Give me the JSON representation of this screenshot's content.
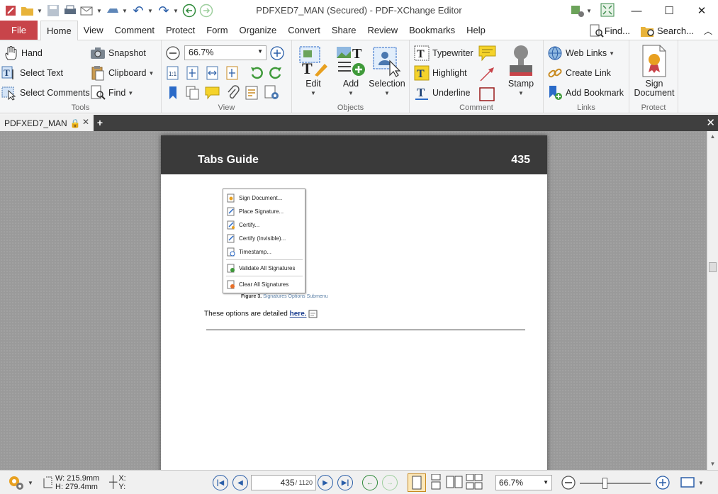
{
  "window": {
    "title": "PDFXED7_MAN (Secured) - PDF-XChange Editor",
    "controls": [
      "minimize",
      "maximize",
      "close"
    ]
  },
  "menu": {
    "file_label": "File",
    "tabs": [
      "Home",
      "View",
      "Comment",
      "Protect",
      "Form",
      "Organize",
      "Convert",
      "Share",
      "Review",
      "Bookmarks",
      "Help"
    ],
    "active_tab": "Home",
    "find_label": "Find...",
    "search_label": "Search..."
  },
  "ribbon": {
    "tools": {
      "label": "Tools",
      "hand": "Hand",
      "select_text": "Select Text",
      "select_comments": "Select Comments",
      "snapshot": "Snapshot",
      "clipboard": "Clipboard",
      "find": "Find"
    },
    "view": {
      "label": "View",
      "zoom_value": "66.7%"
    },
    "objects": {
      "label": "Objects",
      "edit": "Edit",
      "add": "Add",
      "selection": "Selection"
    },
    "comment": {
      "label": "Comment",
      "typewriter": "Typewriter",
      "highlight": "Highlight",
      "underline": "Underline",
      "stamp": "Stamp"
    },
    "links": {
      "label": "Links",
      "web_links": "Web Links",
      "create_link": "Create Link",
      "add_bookmark": "Add Bookmark"
    },
    "protect": {
      "label": "Protect",
      "sign_line1": "Sign",
      "sign_line2": "Document"
    }
  },
  "doc_tab": {
    "name": "PDFXED7_MAN"
  },
  "page": {
    "header_title": "Tabs Guide",
    "page_number": "435",
    "submenu_items": [
      "Sign Document...",
      "Place Signature...",
      "Certify...",
      "Certify (Invisible)...",
      "Timestamp...",
      "Validate All Signatures",
      "Clear All Signatures"
    ],
    "figure_label": "Figure 3.",
    "figure_caption": "Signatures Options Submenu",
    "body_text": "These options are detailed",
    "body_link": "here."
  },
  "status": {
    "width": "W: 215.9mm",
    "height": "H: 279.4mm",
    "x_label": "X:",
    "y_label": "Y:",
    "current_page": "435",
    "total_pages": "/ 1120",
    "zoom": "66.7%",
    "zoom_slider_fraction": 0.35
  }
}
